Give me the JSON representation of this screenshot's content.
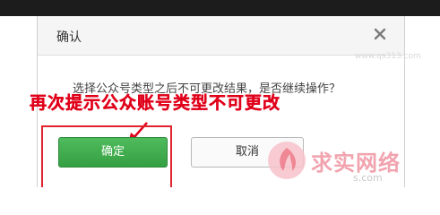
{
  "dialog": {
    "title": "确认",
    "message": "选择公众号类型之后不可更改结果，是否继续操作？",
    "confirm_label": "确定",
    "cancel_label": "取消",
    "close_icon": "close-icon"
  },
  "annotation": {
    "text": "再次提示公众账号类型不可更改",
    "color": "#e0001a"
  },
  "watermark": {
    "url": "www.qs313.com",
    "brand": "求实网络",
    "sub": "s.com"
  },
  "colors": {
    "confirm_green": "#3aa648",
    "highlight_red": "#e0232e"
  }
}
